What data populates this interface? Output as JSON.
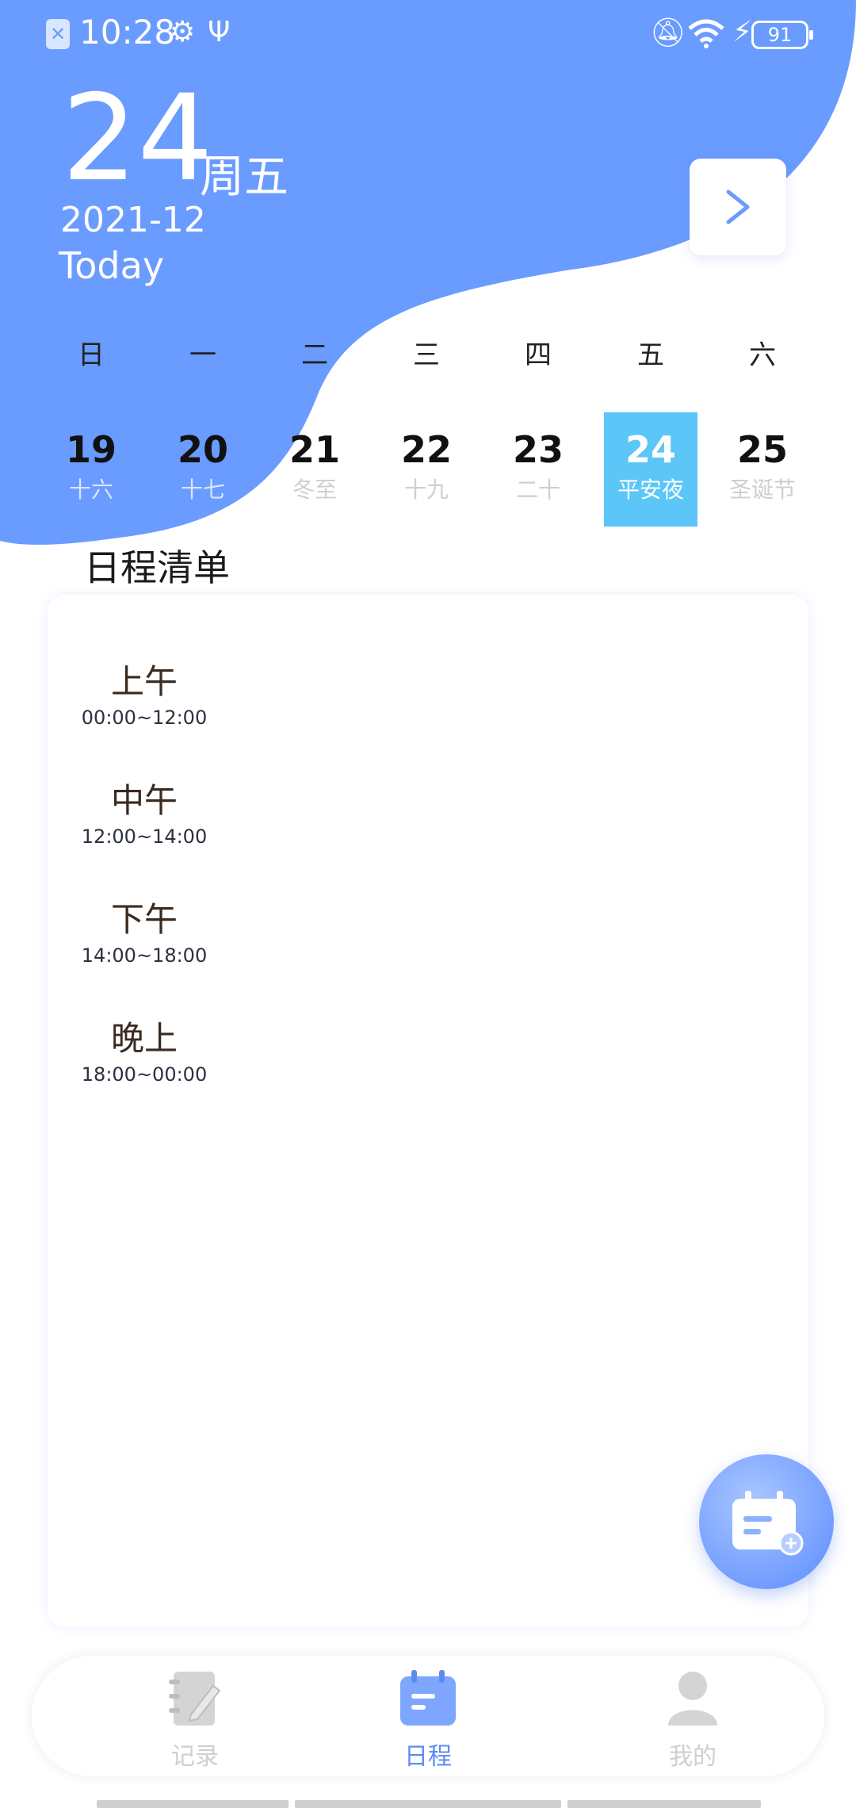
{
  "status_bar": {
    "time": "10:28",
    "sim_icon": "sim-disabled-icon",
    "battery": "91"
  },
  "header": {
    "day": "24",
    "weekday": "周五",
    "year_month": "2021-12",
    "today_label": "Today"
  },
  "week": {
    "weekday_labels": [
      "日",
      "一",
      "二",
      "三",
      "四",
      "五",
      "六"
    ],
    "days": [
      {
        "num": "19",
        "lunar": "十六"
      },
      {
        "num": "20",
        "lunar": "十七"
      },
      {
        "num": "21",
        "lunar": "冬至"
      },
      {
        "num": "22",
        "lunar": "十九"
      },
      {
        "num": "23",
        "lunar": "二十"
      },
      {
        "num": "24",
        "lunar": "平安夜"
      },
      {
        "num": "25",
        "lunar": "圣诞节"
      }
    ],
    "selected_index": 5
  },
  "schedule": {
    "title": "日程清单",
    "slots": [
      {
        "name": "上午",
        "range": "00:00~12:00"
      },
      {
        "name": "中午",
        "range": "12:00~14:00"
      },
      {
        "name": "下午",
        "range": "14:00~18:00"
      },
      {
        "name": "晚上",
        "range": "18:00~00:00"
      }
    ]
  },
  "nav": {
    "items": [
      {
        "label": "记录",
        "icon": "notebook-icon"
      },
      {
        "label": "日程",
        "icon": "calendar-icon"
      },
      {
        "label": "我的",
        "icon": "person-icon"
      }
    ],
    "active_index": 1
  },
  "colors": {
    "accent": "#6a9bff",
    "selected_day": "#5cc6f8",
    "nav_active": "#5b8cf0",
    "inactive": "#cfcfcf"
  }
}
